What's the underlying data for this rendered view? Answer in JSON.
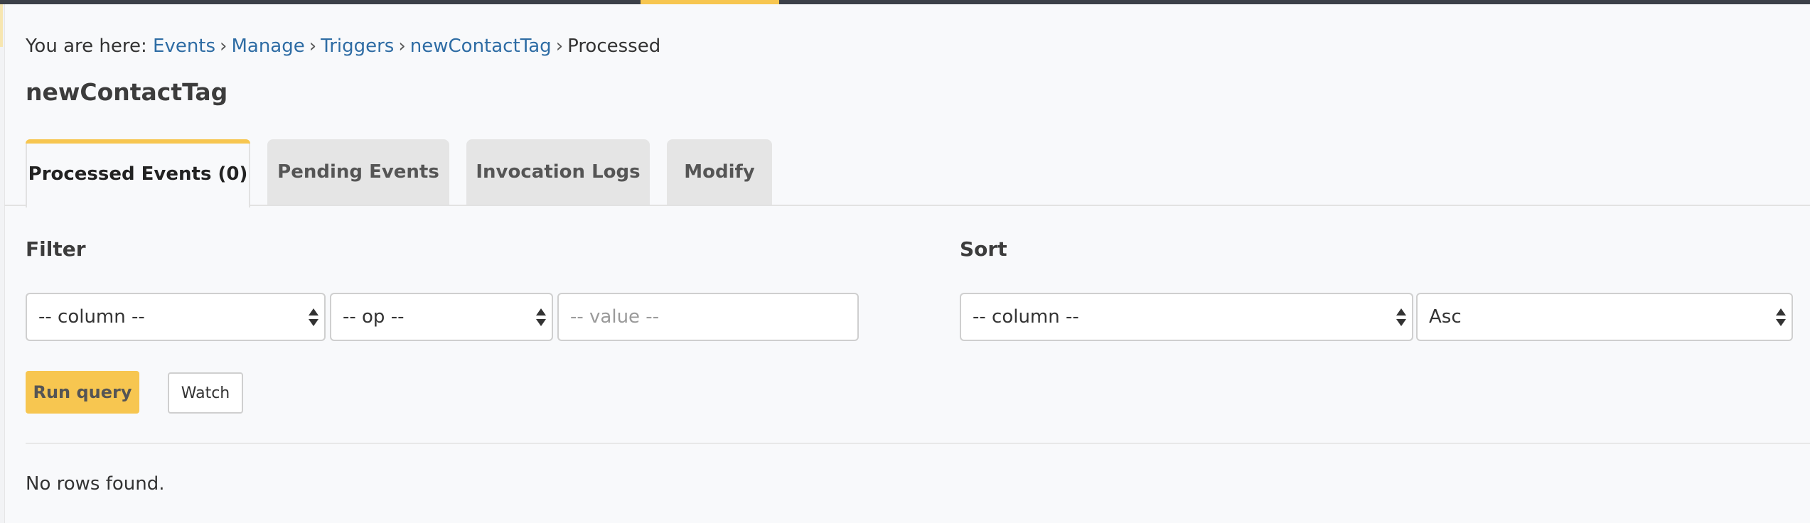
{
  "breadcrumb": {
    "prefix": "You are here:",
    "items": [
      "Events",
      "Manage",
      "Triggers",
      "newContactTag"
    ],
    "current": "Processed"
  },
  "page_title": "newContactTag",
  "tabs": [
    {
      "label": "Processed Events (0)",
      "active": true
    },
    {
      "label": "Pending Events",
      "active": false
    },
    {
      "label": "Invocation Logs",
      "active": false
    },
    {
      "label": "Modify",
      "active": false
    }
  ],
  "filter": {
    "label": "Filter",
    "column_value": "-- column --",
    "op_value": "-- op --",
    "value_placeholder": "-- value --"
  },
  "sort": {
    "label": "Sort",
    "column_value": "-- column --",
    "order_value": "Asc"
  },
  "buttons": {
    "run_query": "Run query",
    "watch": "Watch"
  },
  "results": {
    "empty_message": "No rows found."
  },
  "colors": {
    "accent": "#f7c650",
    "link": "#2e6ca4",
    "topbar": "#3c4048"
  }
}
